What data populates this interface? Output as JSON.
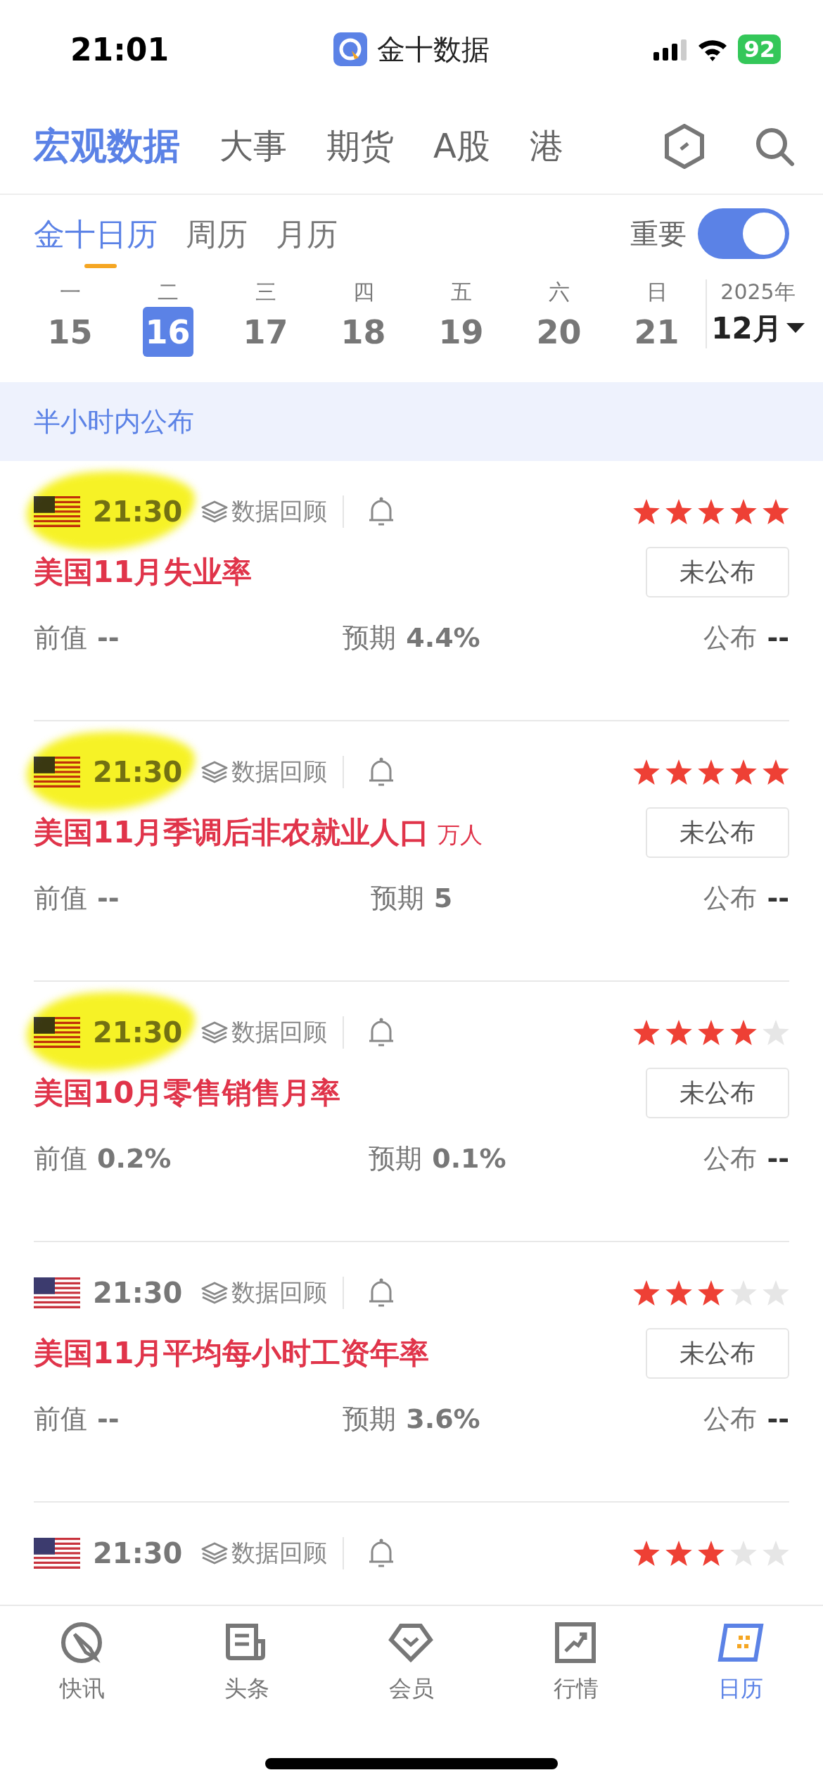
{
  "status_bar": {
    "time": "21:01",
    "app": "金十数据",
    "battery": "92"
  },
  "top_tabs": [
    {
      "label": "宏观数据",
      "selected": true
    },
    {
      "label": "大事",
      "selected": false
    },
    {
      "label": "期货",
      "selected": false
    },
    {
      "label": "A股",
      "selected": false
    },
    {
      "label": "港",
      "selected": false
    }
  ],
  "sub_tabs": [
    {
      "label": "金十日历",
      "selected": true
    },
    {
      "label": "周历",
      "selected": false
    },
    {
      "label": "月历",
      "selected": false
    }
  ],
  "important_toggle": {
    "label": "重要",
    "on": true
  },
  "week": [
    {
      "weekday": "一",
      "date": "15",
      "selected": false
    },
    {
      "weekday": "二",
      "date": "16",
      "selected": true
    },
    {
      "weekday": "三",
      "date": "17",
      "selected": false
    },
    {
      "weekday": "四",
      "date": "18",
      "selected": false
    },
    {
      "weekday": "五",
      "date": "19",
      "selected": false
    },
    {
      "weekday": "六",
      "date": "20",
      "selected": false
    },
    {
      "weekday": "日",
      "date": "21",
      "selected": false
    }
  ],
  "year": "2025年",
  "month": "12月",
  "section_title": "半小时内公布",
  "events": [
    {
      "time": "21:30",
      "review": "数据回顾",
      "stars": 5,
      "highlighted": true,
      "title": "美国11月失业率",
      "status": "未公布",
      "previous_label": "前值",
      "previous": "--",
      "forecast_label": "预期",
      "forecast": "4.4%",
      "actual_label": "公布",
      "actual": "--"
    },
    {
      "time": "21:30",
      "review": "数据回顾",
      "stars": 5,
      "highlighted": true,
      "title": "美国11月季调后非农就业人口",
      "unit": "万人",
      "status": "未公布",
      "previous_label": "前值",
      "previous": "--",
      "forecast_label": "预期",
      "forecast": "5",
      "actual_label": "公布",
      "actual": "--"
    },
    {
      "time": "21:30",
      "review": "数据回顾",
      "stars": 4,
      "highlighted": true,
      "title": "美国10月零售销售月率",
      "status": "未公布",
      "previous_label": "前值",
      "previous": "0.2%",
      "forecast_label": "预期",
      "forecast": "0.1%",
      "actual_label": "公布",
      "actual": "--"
    },
    {
      "time": "21:30",
      "review": "数据回顾",
      "stars": 3,
      "highlighted": false,
      "title": "美国11月平均每小时工资年率",
      "status": "未公布",
      "previous_label": "前值",
      "previous": "--",
      "forecast_label": "预期",
      "forecast": "3.6%",
      "actual_label": "公布",
      "actual": "--"
    },
    {
      "time": "21:30",
      "review": "数据回顾",
      "stars": 3,
      "highlighted": false
    }
  ],
  "bottom_tabs": [
    {
      "label": "快讯",
      "selected": false
    },
    {
      "label": "头条",
      "selected": false
    },
    {
      "label": "会员",
      "selected": false
    },
    {
      "label": "行情",
      "selected": false
    },
    {
      "label": "日历",
      "selected": true
    }
  ]
}
